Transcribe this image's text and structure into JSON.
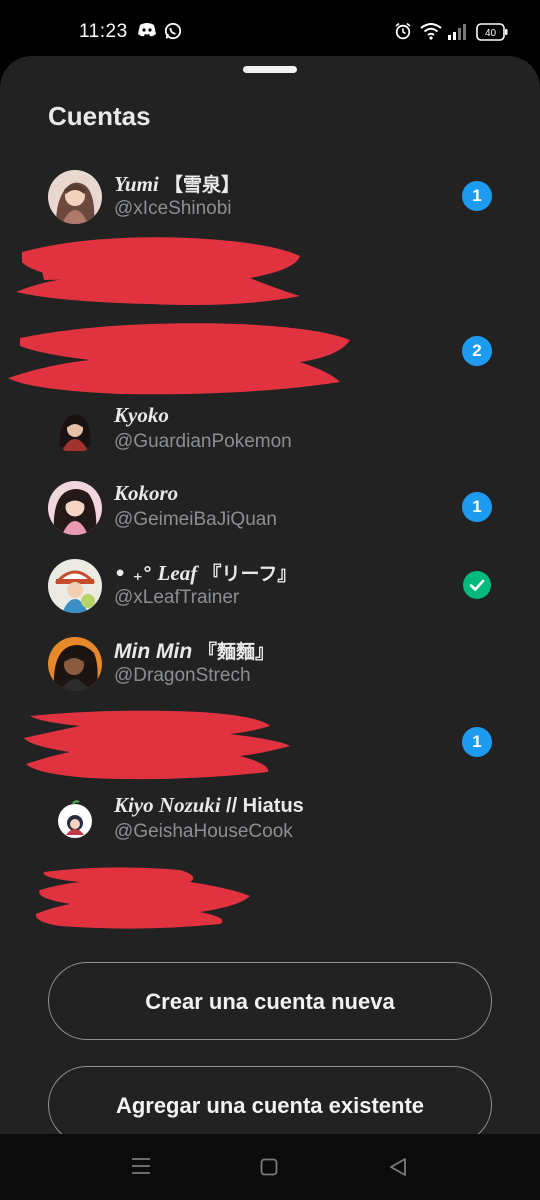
{
  "status_bar": {
    "time": "11:23",
    "icons": [
      "discord-icon",
      "whatsapp-icon",
      "alarm-icon",
      "wifi-icon",
      "signal-icon",
      "battery-icon"
    ],
    "battery_level": "40"
  },
  "sheet": {
    "title": "Cuentas",
    "accounts": [
      {
        "name": "Yumi",
        "name_suffix": "【雪泉】",
        "handle": "@xIceShinobi",
        "badge": "1"
      },
      {
        "name": "Kyoko",
        "handle": "@GuardianPokemon"
      },
      {
        "name": "Kokoro",
        "handle": "@GeimeiBaJiQuan",
        "badge": "1"
      },
      {
        "name_prefix": "• ₊°",
        "name": "Leaf",
        "name_suffix": "『リーフ』",
        "handle": "@xLeafTrainer",
        "active": true
      },
      {
        "name": "Min Min",
        "name_suffix": "『麵麵』",
        "handle": "@DragonStrech"
      },
      {
        "name": "Kiyo Nozuki",
        "name_suffix": "// Hiatus",
        "handle": "@GeishaHouseCook"
      }
    ],
    "redacted_badges": [
      "2",
      "1"
    ],
    "buttons": {
      "create": "Crear una cuenta nueva",
      "add_existing": "Agregar una cuenta existente"
    }
  },
  "colors": {
    "sheet_background": "#222223",
    "badge_blue": "#1d9bf0",
    "active_green": "#00ba7c",
    "redaction_red": "#e0333f"
  }
}
